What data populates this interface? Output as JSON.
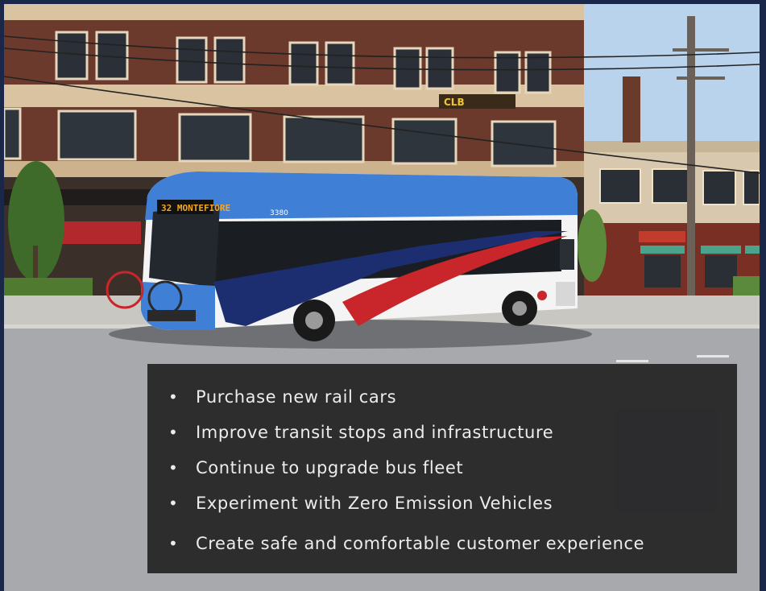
{
  "slide": {
    "bullets": [
      "Purchase new rail cars",
      "Improve transit stops and infrastructure",
      "Continue to upgrade bus fleet",
      "Experiment with Zero Emission Vehicles",
      "Create safe and comfortable customer experience"
    ]
  },
  "photo": {
    "subject": "city transit bus in front of brick buildings",
    "bus_destination_sign": "32 MONTEFIORE",
    "bus_number": "3380",
    "building_sign": "CLB"
  },
  "colors": {
    "frame": "#1a2748",
    "panel": "#18181a",
    "bus_blue": "#3f7fd6",
    "bus_red": "#c8262b",
    "bus_navy": "#1d2e70",
    "brick": "#6b3a2c",
    "sky": "#a9c9e8"
  }
}
